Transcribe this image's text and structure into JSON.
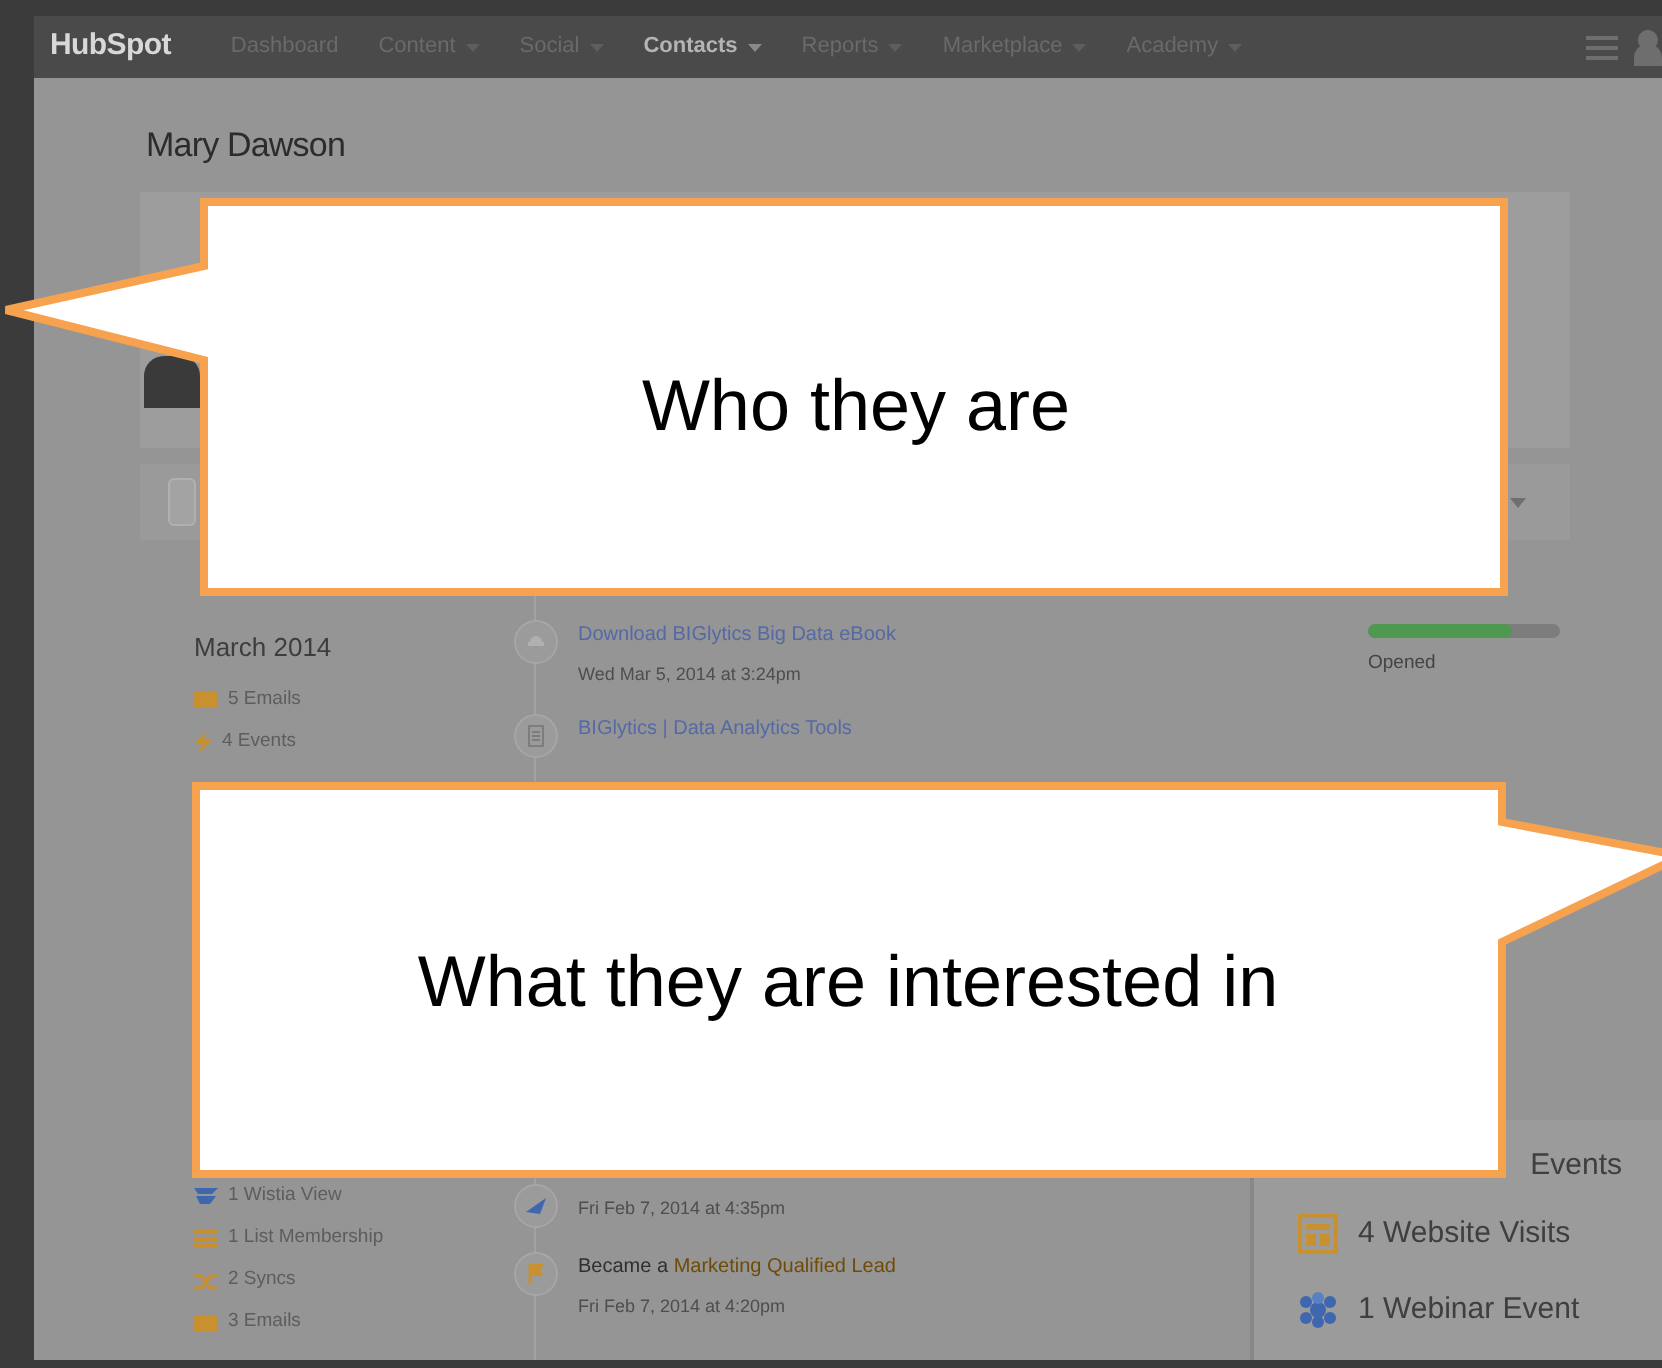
{
  "navbar": {
    "logo": "HubSpot",
    "items": [
      {
        "label": "Dashboard",
        "dropdown": false,
        "selected": false
      },
      {
        "label": "Content",
        "dropdown": true,
        "selected": false
      },
      {
        "label": "Social",
        "dropdown": true,
        "selected": false
      },
      {
        "label": "Contacts",
        "dropdown": true,
        "selected": true
      },
      {
        "label": "Reports",
        "dropdown": true,
        "selected": false
      },
      {
        "label": "Marketplace",
        "dropdown": true,
        "selected": false
      },
      {
        "label": "Academy",
        "dropdown": true,
        "selected": false
      }
    ]
  },
  "contact": {
    "name": "Mary Dawson"
  },
  "summary_top": {
    "heading": "March 2014",
    "items": [
      {
        "kind": "email",
        "label": "5 Emails"
      },
      {
        "kind": "event",
        "label": "4 Events"
      }
    ]
  },
  "summary_bottom": {
    "items": [
      {
        "kind": "wistia",
        "label": "1 Wistia View"
      },
      {
        "kind": "list",
        "label": "1 List Membership"
      },
      {
        "kind": "sync",
        "label": "2 Syncs"
      },
      {
        "kind": "email",
        "label": "3 Emails"
      }
    ]
  },
  "timeline_top": [
    {
      "kind": "download",
      "title": "Download BIGlytics Big Data eBook",
      "time": "Wed Mar 5, 2014 at 3:24pm"
    },
    {
      "kind": "page",
      "title": "BIGlytics | Data Analytics Tools"
    }
  ],
  "timeline_bottom": [
    {
      "kind": "social",
      "time": "Fri Feb 7, 2014 at 4:35pm"
    },
    {
      "kind": "lifecycle",
      "prefix": "Became a",
      "stage": "Marketing Qualified Lead",
      "time": "Fri Feb 7, 2014 at 4:20pm"
    }
  ],
  "email_stats": {
    "level": 0.75,
    "label": "Opened"
  },
  "activity_totals": [
    {
      "label": "Events"
    },
    {
      "kind": "visit",
      "label": "4 Website Visits"
    },
    {
      "kind": "webinar",
      "label": "1 Webinar Event"
    }
  ],
  "callouts": [
    {
      "text": "Who they are",
      "kind": "left"
    },
    {
      "text": "What they are interested in",
      "kind": "right"
    }
  ]
}
